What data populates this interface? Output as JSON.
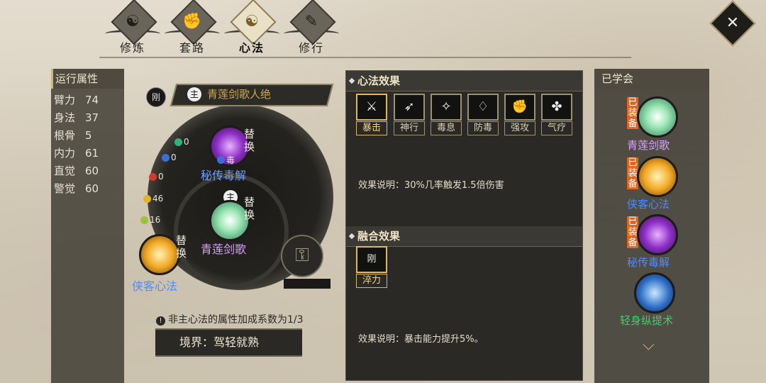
{
  "tabs": [
    {
      "label": "修炼",
      "icon": "swirl-icon",
      "active": false
    },
    {
      "label": "套路",
      "icon": "fist-icon",
      "active": false
    },
    {
      "label": "心法",
      "icon": "yinyang-icon",
      "active": true
    },
    {
      "label": "修行",
      "icon": "scroll-icon",
      "active": false
    }
  ],
  "close_label": "✕",
  "attributes": {
    "header": "运行属性",
    "rows": [
      {
        "label": "臂力",
        "value": "74"
      },
      {
        "label": "身法",
        "value": "37"
      },
      {
        "label": "根骨",
        "value": "5"
      },
      {
        "label": "内力",
        "value": "61"
      },
      {
        "label": "直觉",
        "value": "60"
      },
      {
        "label": "警觉",
        "value": "60"
      }
    ]
  },
  "main_method": {
    "gang": "刚",
    "zhu": "主",
    "name": "青莲剑歌人绝"
  },
  "slots": {
    "top": {
      "name": "秘传毒解",
      "swap": "替换",
      "tag": "毒"
    },
    "center": {
      "name": "青莲剑歌",
      "swap": "替换",
      "badge": "主"
    },
    "left": {
      "name": "侠客心法",
      "swap": "替换"
    }
  },
  "mini_stats": [
    {
      "text": "0",
      "color": "#2fb37a"
    },
    {
      "text": "0",
      "color": "#3a6fd8"
    },
    {
      "text": "0",
      "color": "#d23b2a"
    },
    {
      "text": "46",
      "color": "#e3b526"
    },
    {
      "text": "16",
      "color": "#9bc23a"
    }
  ],
  "note": "非主心法的属性加成系数为1/3",
  "realm": "境界：驾轻就熟",
  "effects": {
    "header": "心法效果",
    "items": [
      "暴击",
      "神行",
      "毒息",
      "防毒",
      "强攻",
      "气疗"
    ],
    "desc": "效果说明：30%几率触发1.5倍伤害"
  },
  "fusion": {
    "header": "融合效果",
    "item_icon": "刚",
    "item": "淬力",
    "desc": "效果说明：暴击能力提升5%。"
  },
  "learned": {
    "header": "已学会",
    "equipped_label": "已装备",
    "items": [
      {
        "name": "青莲剑歌",
        "color": "#d9a2ff",
        "equipped": true
      },
      {
        "name": "侠客心法",
        "color": "#4d8cff",
        "equipped": true
      },
      {
        "name": "秘传毒解",
        "color": "#4d8cff",
        "equipped": true
      },
      {
        "name": "轻身纵提术",
        "color": "#3fcf68",
        "equipped": false
      }
    ]
  }
}
